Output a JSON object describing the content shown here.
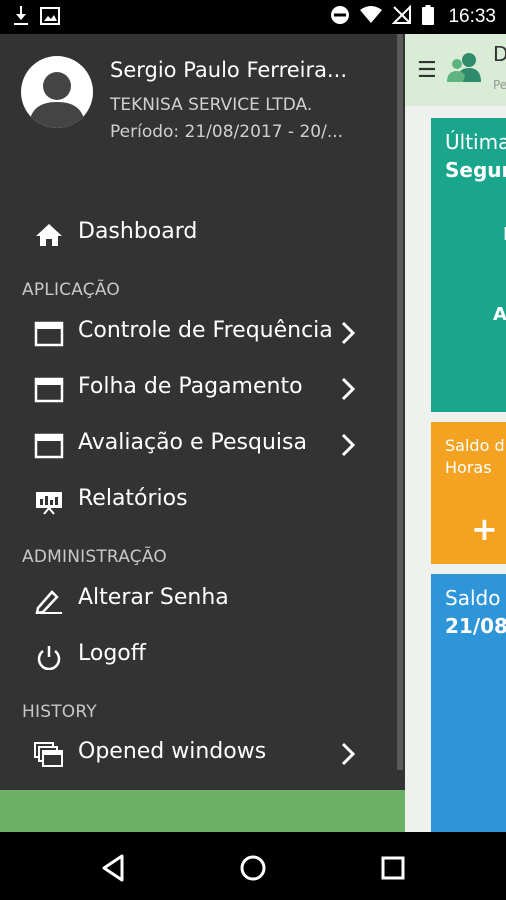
{
  "status_bar": {
    "time": "16:33",
    "left_icons": [
      "download-icon",
      "image-icon"
    ],
    "right_icons": [
      "do-not-disturb-icon",
      "wifi-icon",
      "no-sim-icon",
      "battery-icon"
    ]
  },
  "drawer": {
    "user": {
      "name": "Sergio Paulo Ferreira...",
      "company": "TEKNISA SERVICE LTDA.",
      "period": "Período: 21/08/2017 - 20/..."
    },
    "dashboard": {
      "label": "Dashboard",
      "icon": "home-icon"
    },
    "section_application": "APLICAÇÃO",
    "application_items": [
      {
        "label": "Controle de Frequência",
        "icon": "window-icon",
        "has_submenu": true
      },
      {
        "label": "Folha de Pagamento",
        "icon": "window-icon",
        "has_submenu": true
      },
      {
        "label": "Avaliação e Pesquisa",
        "icon": "window-icon",
        "has_submenu": true
      },
      {
        "label": "Relatórios",
        "icon": "presentation-icon",
        "has_submenu": false
      }
    ],
    "section_admin": "ADMINISTRAÇÃO",
    "admin_items": [
      {
        "label": "Alterar Senha",
        "icon": "pencil-icon"
      },
      {
        "label": "Logoff",
        "icon": "power-icon"
      }
    ],
    "section_history": "HISTORY",
    "history_items": [
      {
        "label": "Opened windows",
        "icon": "windows-stack-icon",
        "has_submenu": true
      }
    ]
  },
  "background_app": {
    "header_title": "D",
    "header_subtitle": "Pe",
    "cards": {
      "teal": {
        "line1": "Última",
        "line2": "Segun",
        "mid1": "I",
        "mid2": "A"
      },
      "orange": {
        "line1": "Saldo d",
        "line2": "Horas",
        "plus": "+"
      },
      "blue": {
        "line1": "Saldo",
        "line2": "21/08"
      }
    }
  },
  "colors": {
    "drawer_bg": "#333333",
    "accent_green": "#6db167",
    "teal_card": "#1aa58d",
    "orange_card": "#f3a221",
    "blue_card": "#2f95d9"
  },
  "nav_bar": {
    "buttons": [
      "back",
      "home",
      "recents"
    ]
  }
}
